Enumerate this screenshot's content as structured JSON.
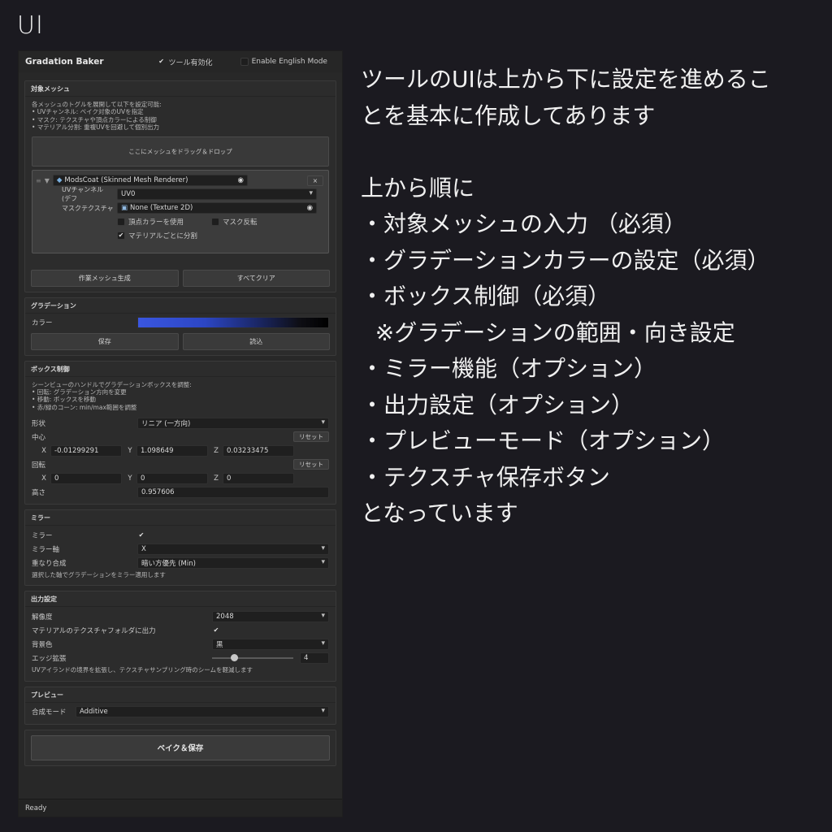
{
  "heading": "UI",
  "window": {
    "title": "Gradation Baker",
    "tool_enable_label": "ツール有効化",
    "tool_enable_checked": true,
    "english_mode_label": "Enable English Mode",
    "english_mode_checked": false
  },
  "target_mesh": {
    "title": "対象メッシュ",
    "help": [
      "各メッシュのトグルを展開して以下を設定可能:",
      "• UVチャンネル: ベイク対象のUVを指定",
      "• マスク: テクスチャや頂点カラーによる制御",
      "• マテリアル分割: 重複UVを回避して個別出力"
    ],
    "dropzone": "ここにメッシュをドラッグ＆ドロップ",
    "mesh_field": "ModsCoat (Skinned Mesh Renderer)",
    "remove": "×",
    "uv_label": "UVチャンネル (デフ",
    "uv_value": "UV0",
    "mask_label": "マスクテクスチャ",
    "mask_value": "None (Texture 2D)",
    "vertex_color_label": "頂点カラーを使用",
    "vertex_color_checked": false,
    "mask_invert_label": "マスク反転",
    "mask_invert_checked": false,
    "split_label": "マテリアルごとに分割",
    "split_checked": true,
    "create_button": "作業メッシュ生成",
    "clear_button": "すべてクリア"
  },
  "gradient": {
    "title": "グラデーション",
    "color_label": "カラー",
    "save_button": "保存",
    "load_button": "読込"
  },
  "box": {
    "title": "ボックス制御",
    "help": [
      "シーンビューのハンドルでグラデーションボックスを調整:",
      "• 回転: グラデーション方向を変更",
      "• 移動: ボックスを移動",
      "• 赤/緑のコーン: min/max範囲を調整"
    ],
    "shape_label": "形状",
    "shape_value": "リニア (一方向)",
    "center_label": "中心",
    "reset": "リセット",
    "center": {
      "x": "-0.01299291",
      "y": "1.098649",
      "z": "0.03233475"
    },
    "rotation_label": "回転",
    "rotation": {
      "x": "0",
      "y": "0",
      "z": "0"
    },
    "height_label": "高さ",
    "height_value": "0.957606",
    "axis_x": "X",
    "axis_y": "Y",
    "axis_z": "Z"
  },
  "mirror": {
    "title": "ミラー",
    "mirror_label": "ミラー",
    "mirror_checked": true,
    "axis_label": "ミラー軸",
    "axis_value": "X",
    "blend_label": "重なり合成",
    "blend_value": "暗い方優先 (Min)",
    "help": "選択した軸でグラデーションをミラー適用します"
  },
  "output": {
    "title": "出力設定",
    "resolution_label": "解像度",
    "resolution_value": "2048",
    "folder_label": "マテリアルのテクスチャフォルダに出力",
    "folder_checked": true,
    "bg_label": "背景色",
    "bg_value": "黒",
    "edge_label": "エッジ拡張",
    "edge_value": "4",
    "edge_fraction": 0.27,
    "help": "UVアイランドの境界を拡張し、テクスチャサンプリング時のシームを軽減します"
  },
  "preview": {
    "title": "プレビュー",
    "mode_label": "合成モード",
    "mode_value": "Additive"
  },
  "bake_button": "ベイク＆保存",
  "status": "Ready",
  "description": [
    "ツールのUIは上から下に設定を進めるこ",
    "とを基本に作成してあります",
    "",
    "上から順に",
    "・対象メッシュの入力 （必須）",
    "・グラデーションカラーの設定（必須）",
    "・ボックス制御（必須）",
    "  ※グラデーションの範囲・向き設定",
    "・ミラー機能（オプション）",
    "・出力設定（オプション）",
    "・プレビューモード（オプション）",
    "・テクスチャ保存ボタン",
    "となっています"
  ]
}
